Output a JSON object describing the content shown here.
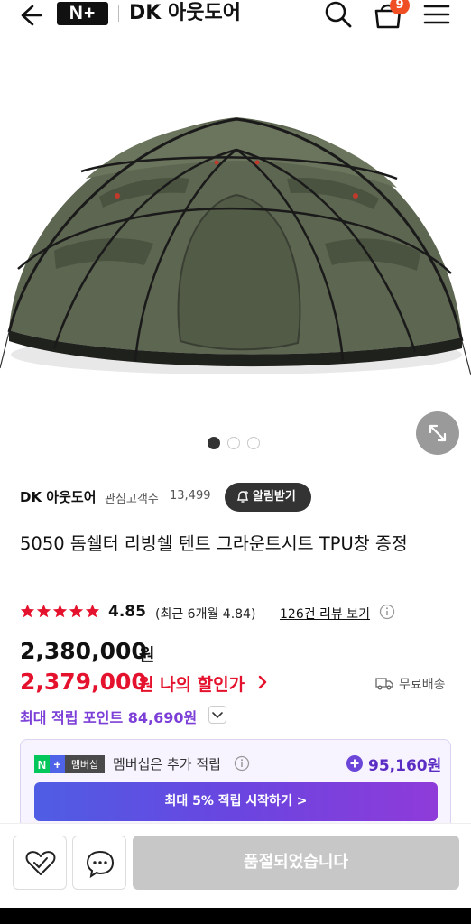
{
  "header": {
    "logo_text": "N+",
    "store_name": "DK 아웃도어",
    "cart_count": "9",
    "icons": [
      "back-arrow-icon",
      "search-icon",
      "cart-icon",
      "menu-icon"
    ]
  },
  "gallery": {
    "image_alt": "dome tent",
    "page_count": 3,
    "active_page": 1,
    "zoom_icon": "expand-icon"
  },
  "store": {
    "seller_name": "DK 아웃도어",
    "follower_label": "관심고객수",
    "follower_count": "13,499",
    "alert_button": "알림받기"
  },
  "product": {
    "title": "5050 돔쉘터 리빙쉘 텐트 그라운트시트 TPU창 증정",
    "rating": "4.85",
    "rating_stars": 5,
    "recent_rating": "(최근 6개월 4.84)",
    "review_link": "126건 리뷰 보기"
  },
  "price": {
    "original": "2,380,000",
    "original_unit": "원",
    "sale": "2,379,000",
    "sale_label": "원 나의 할인가",
    "shipping": "무료배송"
  },
  "points": {
    "label": "최대 적립 포인트 84,690원"
  },
  "membership": {
    "badge": "멤버십",
    "text": "멤버십은 추가 적립",
    "amount": "95,160원",
    "cta": "최대 5% 적립 시작하기 >"
  },
  "bottom": {
    "soldout_label": "품절되었습니다"
  },
  "colors": {
    "accent_red": "#e5122e",
    "points_purple": "#7c3fd7",
    "badge_orange": "#f04e23"
  }
}
